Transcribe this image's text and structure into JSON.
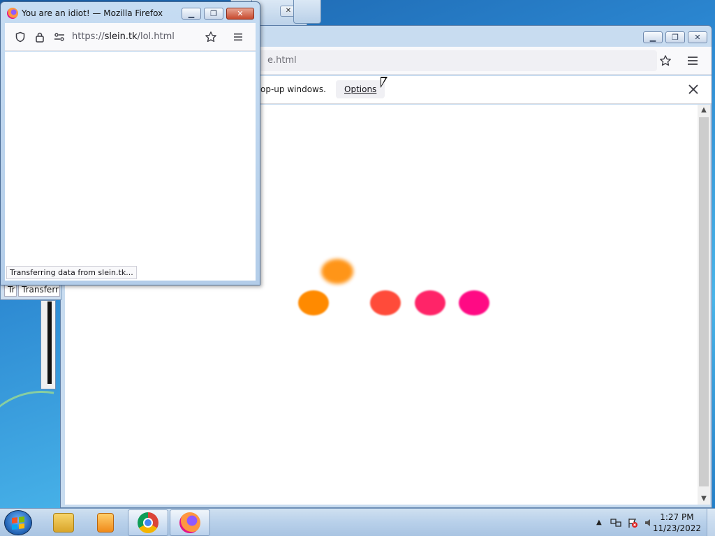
{
  "popup_window": {
    "title": "You are an idiot! — Mozilla Firefox",
    "url_scheme": "https://",
    "url_host": "slein.tk",
    "url_path": "/lol.html",
    "status": "Transferring data from slein.tk..."
  },
  "main_window": {
    "url_fragment": "e.html",
    "notification_text": "op-up windows.",
    "options_label": "Options"
  },
  "background_windows": {
    "status_fragment_1": "Tr",
    "status_fragment_2": "Transferrir"
  },
  "window_controls": {
    "minimize": "▁",
    "restore": "❐",
    "close": "✕"
  },
  "loading_dots": {
    "colors": [
      "#ff8a00",
      "#ff8a00",
      "#ff4b3a",
      "#ff2468",
      "#ff0a84"
    ]
  },
  "taskbar": {
    "pinned": [
      "windows-explorer",
      "media-player",
      "google-chrome",
      "firefox"
    ],
    "time": "1:27 PM",
    "date": "11/23/2022"
  },
  "colors": {
    "accent_orange": "#ff8a00",
    "accent_magenta": "#ff0a84"
  }
}
